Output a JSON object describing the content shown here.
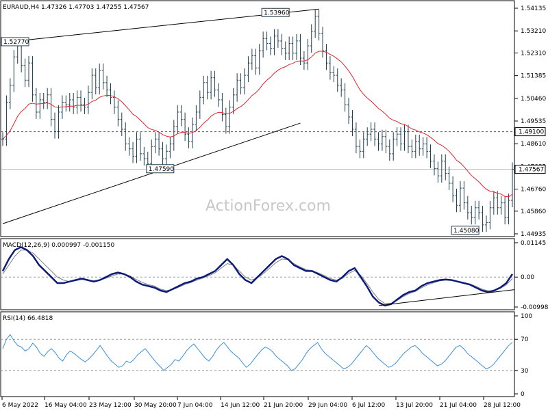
{
  "chart_data": {
    "type": "line",
    "symbol": "EURAUD,H4",
    "header": "EURAUD,H4  1.47326 1.47703 1.47255 1.47567",
    "ohlc": {
      "open": 1.47326,
      "high": 1.47703,
      "low": 1.47255,
      "close": 1.47567
    },
    "watermark": "ActionForex.com",
    "x_labels": [
      "6 May 2022",
      "16 May 04:00",
      "23 May 12:00",
      "30 May 20:00",
      "7 Jun 04:00",
      "14 Jun 12:00",
      "21 Jun 20:00",
      "29 Jun 04:00",
      "6 Jul 12:00",
      "13 Jul 20:00",
      "21 Jul 04:00",
      "28 Jul 12:00"
    ],
    "price_panel": {
      "y_ticks": [
        "1.54135",
        "1.53210",
        "1.52310",
        "1.51385",
        "1.50460",
        "1.49535",
        "1.48610",
        "1.47685",
        "1.46760",
        "1.45860",
        "1.44935"
      ],
      "ylim": [
        1.44935,
        1.54135
      ],
      "close_series": [
        1.488,
        1.503,
        1.51,
        1.5215,
        1.526,
        1.518,
        1.512,
        1.519,
        1.506,
        1.499,
        1.504,
        1.503,
        1.506,
        1.496,
        1.491,
        1.499,
        1.503,
        1.502,
        1.504,
        1.501,
        1.505,
        1.502,
        1.501,
        1.507,
        1.514,
        1.509,
        1.516,
        1.511,
        1.508,
        1.505,
        1.501,
        1.496,
        1.492,
        1.486,
        1.484,
        1.481,
        1.488,
        1.482,
        1.48,
        1.478,
        1.485,
        1.488,
        1.484,
        1.48,
        1.483,
        1.486,
        1.493,
        1.499,
        1.496,
        1.49,
        1.487,
        1.494,
        1.499,
        1.505,
        1.511,
        1.507,
        1.513,
        1.508,
        1.504,
        1.498,
        1.493,
        1.501,
        1.506,
        1.512,
        1.509,
        1.514,
        1.519,
        1.522,
        1.517,
        1.524,
        1.529,
        1.527,
        1.525,
        1.53,
        1.528,
        1.525,
        1.523,
        1.527,
        1.523,
        1.528,
        1.521,
        1.519,
        1.526,
        1.532,
        1.538,
        1.531,
        1.524,
        1.519,
        1.515,
        1.514,
        1.51,
        1.508,
        1.502,
        1.497,
        1.492,
        1.485,
        1.483,
        1.488,
        1.49,
        1.492,
        1.488,
        1.486,
        1.489,
        1.485,
        1.482,
        1.488,
        1.49,
        1.486,
        1.491,
        1.485,
        1.483,
        1.487,
        1.484,
        1.486,
        1.483,
        1.479,
        1.476,
        1.473,
        1.479,
        1.474,
        1.47,
        1.465,
        1.461,
        1.468,
        1.462,
        1.458,
        1.456,
        1.46,
        1.458,
        1.453,
        1.454,
        1.46,
        1.464,
        1.46,
        1.462,
        1.456,
        1.463,
        1.4757
      ],
      "ema": {
        "name": "EMA",
        "color": "#e8202a"
      },
      "resistance_line_label": "1.49100",
      "current_price_label": "1.47567",
      "callouts": [
        "1.52770",
        "1.53960",
        "1.47590",
        "1.45080"
      ]
    },
    "macd_panel": {
      "label": "MACD(12,26,9) 0.000997 -0.001150",
      "y_ticks": [
        "0.01145",
        "0.00",
        "-0.009985"
      ],
      "ylim": [
        -0.009985,
        0.01145
      ],
      "main": [
        0.002,
        0.006,
        0.009,
        0.01,
        0.009,
        0.007,
        0.004,
        0.002,
        0.0,
        -0.002,
        -0.002,
        -0.0015,
        -0.001,
        -0.0005,
        -0.001,
        -0.0015,
        -0.001,
        0.0,
        0.001,
        0.0015,
        0.001,
        0.0,
        -0.0015,
        -0.0025,
        -0.003,
        -0.0035,
        -0.0045,
        -0.005,
        -0.004,
        -0.003,
        -0.002,
        -0.0015,
        -0.0005,
        0.0,
        0.001,
        0.002,
        0.004,
        0.006,
        0.004,
        0.001,
        -0.001,
        -0.002,
        0.0,
        0.002,
        0.004,
        0.006,
        0.007,
        0.006,
        0.004,
        0.003,
        0.002,
        0.002,
        0.001,
        0.0,
        -0.001,
        -0.0015,
        0.0,
        0.002,
        0.003,
        0.0,
        -0.003,
        -0.0065,
        -0.0085,
        -0.0095,
        -0.009,
        -0.0075,
        -0.006,
        -0.005,
        -0.0045,
        -0.003,
        -0.002,
        -0.0015,
        -0.001,
        -0.0008,
        -0.001,
        -0.0015,
        -0.002,
        -0.0025,
        -0.0035,
        -0.0045,
        -0.005,
        -0.0045,
        -0.0035,
        -0.002,
        0.001
      ],
      "signal": [
        0.001,
        0.004,
        0.007,
        0.009,
        0.009,
        0.008,
        0.006,
        0.004,
        0.002,
        0.0,
        -0.001,
        -0.0015,
        -0.0012,
        -0.0008,
        -0.001,
        -0.0012,
        -0.001,
        -0.0004,
        0.0004,
        0.001,
        0.001,
        0.0004,
        -0.0008,
        -0.0018,
        -0.0025,
        -0.003,
        -0.004,
        -0.0045,
        -0.0042,
        -0.0034,
        -0.0025,
        -0.0018,
        -0.001,
        -0.0003,
        0.0005,
        0.0014,
        0.003,
        0.0045,
        0.004,
        0.002,
        0.0,
        -0.001,
        -0.0002,
        0.0012,
        0.003,
        0.0048,
        0.006,
        0.0058,
        0.0045,
        0.0034,
        0.0025,
        0.0021,
        0.0014,
        0.0005,
        -0.0005,
        -0.001,
        -0.0004,
        0.0012,
        0.0022,
        0.0006,
        -0.002,
        -0.005,
        -0.0075,
        -0.0088,
        -0.0088,
        -0.0078,
        -0.0065,
        -0.0055,
        -0.0048,
        -0.0036,
        -0.0026,
        -0.0019,
        -0.0013,
        -0.001,
        -0.0011,
        -0.0014,
        -0.0018,
        -0.0023,
        -0.0031,
        -0.004,
        -0.0046,
        -0.0045,
        -0.0038,
        -0.0026,
        -0.0005
      ],
      "colors": {
        "main": "#0b1b7a",
        "signal": "#7f7f7f"
      }
    },
    "rsi_panel": {
      "label": "RSI(14) 66.4818",
      "y_ticks": [
        "100",
        "70",
        "30",
        "0"
      ],
      "ylim": [
        0,
        100
      ],
      "values": [
        58,
        70,
        76,
        68,
        62,
        60,
        55,
        58,
        65,
        60,
        52,
        48,
        54,
        58,
        53,
        46,
        42,
        50,
        55,
        52,
        48,
        44,
        41,
        45,
        50,
        56,
        62,
        55,
        48,
        42,
        38,
        34,
        36,
        42,
        40,
        44,
        50,
        54,
        58,
        52,
        46,
        40,
        35,
        30,
        34,
        38,
        44,
        42,
        48,
        55,
        60,
        64,
        58,
        52,
        46,
        42,
        48,
        56,
        62,
        66,
        60,
        54,
        50,
        46,
        40,
        34,
        38,
        44,
        50,
        56,
        60,
        58,
        54,
        48,
        44,
        40,
        36,
        30,
        32,
        38,
        44,
        52,
        58,
        62,
        66,
        58,
        52,
        48,
        44,
        40,
        36,
        32,
        34,
        38,
        44,
        50,
        56,
        62,
        58,
        52,
        46,
        42,
        38,
        34,
        36,
        40,
        46,
        52,
        56,
        60,
        62,
        58,
        52,
        48,
        44,
        40,
        36,
        38,
        42,
        48,
        54,
        60,
        62,
        58,
        52,
        48,
        44,
        40,
        36,
        32,
        34,
        38,
        44,
        50,
        56,
        62,
        66
      ],
      "color": "#3a8fd9"
    }
  }
}
